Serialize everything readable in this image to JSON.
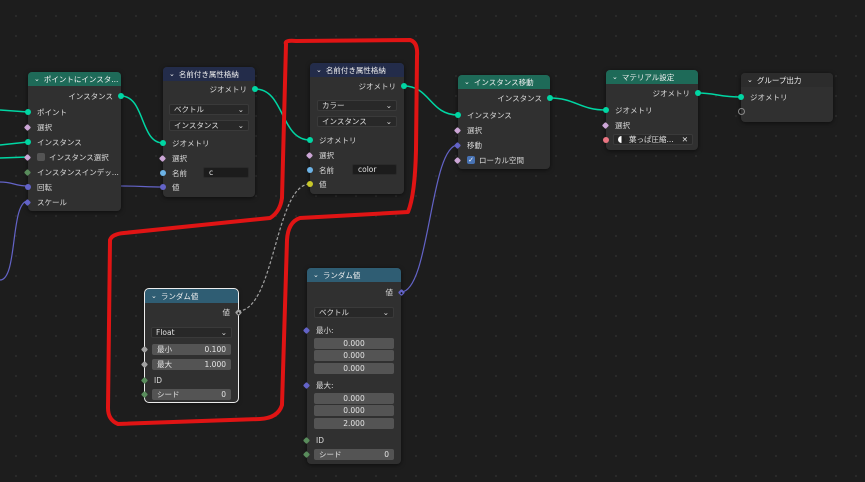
{
  "nodes": {
    "instance_on_points": {
      "title": "ポイントにインスタ...",
      "output": "インスタンス",
      "inputs": [
        "ポイント",
        "選択",
        "インスタンス",
        "インスタンス選択",
        "インスタンスインデッ...",
        "回転",
        "スケール"
      ]
    },
    "store_attr_1": {
      "title": "名前付き属性格納",
      "output": "ジオメトリ",
      "data_type": "ベクトル",
      "domain": "インスタンス",
      "inputs": [
        "ジオメトリ",
        "選択",
        "名前",
        "値"
      ],
      "name_value": "c"
    },
    "store_attr_2": {
      "title": "名前付き属性格納",
      "output": "ジオメトリ",
      "data_type": "カラー",
      "domain": "インスタンス",
      "inputs": [
        "ジオメトリ",
        "選択",
        "名前",
        "値"
      ],
      "name_value": "color"
    },
    "translate_instances": {
      "title": "インスタンス移動",
      "output": "インスタンス",
      "inputs": [
        "インスタンス",
        "選択",
        "移動",
        "ローカル空間"
      ]
    },
    "set_material": {
      "title": "マテリアル設定",
      "output": "ジオメトリ",
      "inputs": [
        "ジオメトリ",
        "選択"
      ],
      "material": "葉っぱ圧縮..."
    },
    "group_output": {
      "title": "グループ出力",
      "input": "ジオメトリ"
    },
    "random_value_1": {
      "title": "ランダム値",
      "output": "値",
      "data_type": "Float",
      "min_label": "最小",
      "min_value": "0.100",
      "max_label": "最大",
      "max_value": "1.000",
      "id_label": "ID",
      "seed_label": "シード",
      "seed_value": "0"
    },
    "random_value_2": {
      "title": "ランダム値",
      "output": "値",
      "data_type": "ベクトル",
      "min_label": "最小:",
      "min_values": [
        "0.000",
        "0.000",
        "0.000"
      ],
      "max_label": "最大:",
      "max_values": [
        "0.000",
        "0.000",
        "2.000"
      ],
      "id_label": "ID",
      "seed_label": "シード",
      "seed_value": "0"
    }
  },
  "colors": {
    "geometry_socket": "#00d6a3",
    "vector_socket": "#6363c7",
    "string_socket": "#6cb3e6",
    "annotation": "#e01414"
  }
}
